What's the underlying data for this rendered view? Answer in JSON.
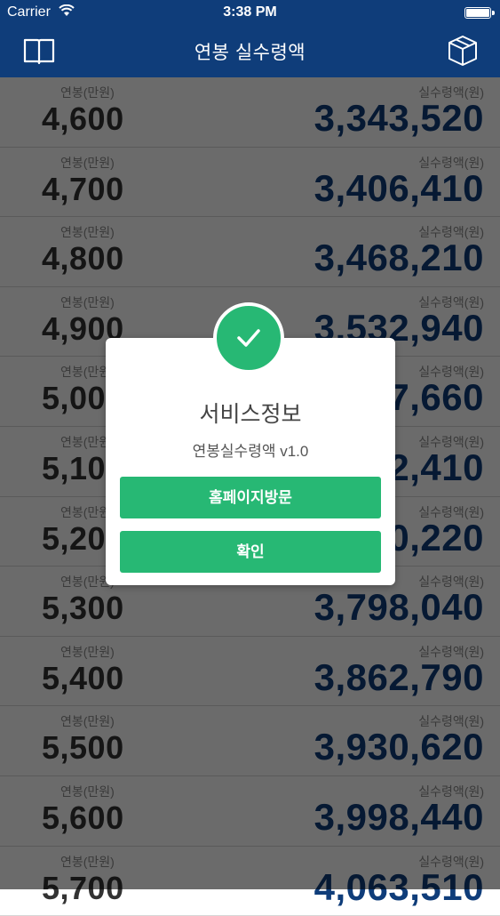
{
  "status_bar": {
    "carrier": "Carrier",
    "time": "3:38 PM"
  },
  "nav": {
    "title": "연봉 실수령액",
    "left_icon": "book-icon",
    "right_icon": "box-icon"
  },
  "list": {
    "salary_label": "연봉(만원)",
    "net_label": "실수령액(원)",
    "rows": [
      {
        "salary": "4,600",
        "net": "3,343,520"
      },
      {
        "salary": "4,700",
        "net": "3,406,410"
      },
      {
        "salary": "4,800",
        "net": "3,468,210"
      },
      {
        "salary": "4,900",
        "net": "3,532,940"
      },
      {
        "salary": "5,000",
        "net": "3,597,660"
      },
      {
        "salary": "5,100",
        "net": "3,662,410"
      },
      {
        "salary": "5,200",
        "net": "3,730,220"
      },
      {
        "salary": "5,300",
        "net": "3,798,040"
      },
      {
        "salary": "5,400",
        "net": "3,862,790"
      },
      {
        "salary": "5,500",
        "net": "3,930,620"
      },
      {
        "salary": "5,600",
        "net": "3,998,440"
      },
      {
        "salary": "5,700",
        "net": "4,063,510"
      }
    ]
  },
  "dialog": {
    "icon": "check-icon",
    "title": "서비스정보",
    "subtitle": "연봉실수령액 v1.0",
    "visit_label": "홈페이지방문",
    "ok_label": "확인"
  },
  "colors": {
    "primary": "#0f3d7a",
    "accent": "#27b874"
  }
}
